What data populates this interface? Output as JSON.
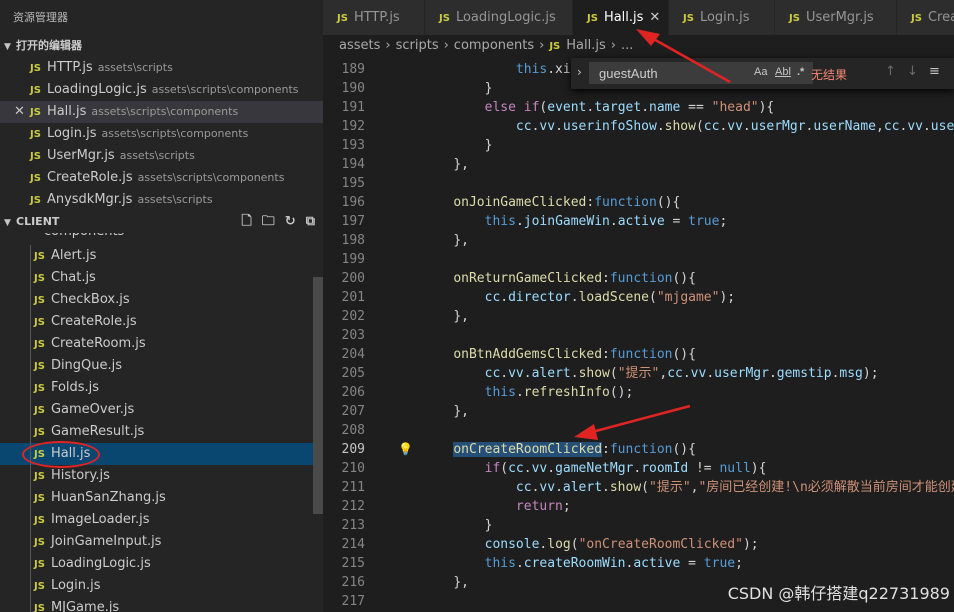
{
  "sidebar": {
    "title": "资源管理器",
    "open_editors_title": "打开的编辑器",
    "open_editors": [
      {
        "name": "HTTP.js",
        "path": "assets\\scripts"
      },
      {
        "name": "LoadingLogic.js",
        "path": "assets\\scripts\\components"
      },
      {
        "name": "Hall.js",
        "path": "assets\\scripts\\components"
      },
      {
        "name": "Login.js",
        "path": "assets\\scripts\\components"
      },
      {
        "name": "UserMgr.js",
        "path": "assets\\scripts"
      },
      {
        "name": "CreateRole.js",
        "path": "assets\\scripts\\components"
      },
      {
        "name": "AnysdkMgr.js",
        "path": "assets\\scripts"
      }
    ],
    "close_glyph": "✕",
    "client_title": "CLIENT",
    "folder": "components",
    "files": [
      "Alert.js",
      "Chat.js",
      "CheckBox.js",
      "CreateRole.js",
      "CreateRoom.js",
      "DingQue.js",
      "Folds.js",
      "GameOver.js",
      "GameResult.js",
      "Hall.js",
      "History.js",
      "HuanSanZhang.js",
      "ImageLoader.js",
      "JoinGameInput.js",
      "LoadingLogic.js",
      "Login.js",
      "MJGame.js"
    ],
    "js_badge": "JS"
  },
  "tabs": [
    {
      "label": "HTTP.js"
    },
    {
      "label": "LoadingLogic.js"
    },
    {
      "label": "Hall.js",
      "active": true
    },
    {
      "label": "Login.js"
    },
    {
      "label": "UserMgr.js"
    },
    {
      "label": "Crea"
    }
  ],
  "breadcrumb": [
    "assets",
    "scripts",
    "components",
    "Hall.js",
    "..."
  ],
  "find": {
    "value": "guestAuth",
    "match_case": "Aa",
    "whole_word": "Abl",
    "regex": ".*",
    "no_results": "无结果"
  },
  "code": {
    "current_line": 209,
    "lines": [
      {
        "n": "189",
        "html": "            <span class='k'>this</span><span class='t'>.xiaox</span>"
      },
      {
        "n": "190",
        "html": "        <span class='t'>}</span>"
      },
      {
        "n": "191",
        "html": "        <span class='kw'>else</span> <span class='kw'>if</span><span class='t'>(</span><span class='p'>event</span><span class='t'>.</span><span class='p'>target</span><span class='t'>.</span><span class='p'>name</span> <span class='t'>==</span> <span class='s'>\"head\"</span><span class='t'>){</span>"
      },
      {
        "n": "192",
        "html": "            <span class='p'>cc</span><span class='t'>.</span><span class='p'>vv</span><span class='t'>.</span><span class='p'>userinfoShow</span><span class='t'>.</span><span class='f'>show</span><span class='t'>(</span><span class='p'>cc</span><span class='t'>.</span><span class='p'>vv</span><span class='t'>.</span><span class='p'>userMgr</span><span class='t'>.</span><span class='p'>userName</span><span class='t'>,</span><span class='p'>cc</span><span class='t'>.</span><span class='p'>vv</span><span class='t'>.</span><span class='p'>userMgr</span><span class='t'>.</span>"
      },
      {
        "n": "193",
        "html": "        <span class='t'>}</span>"
      },
      {
        "n": "194",
        "html": "    <span class='t'>},</span>"
      },
      {
        "n": "195",
        "html": ""
      },
      {
        "n": "196",
        "html": "    <span class='f'>onJoinGameClicked</span><span class='t'>:</span><span class='k'>function</span><span class='t'>(){</span>"
      },
      {
        "n": "197",
        "html": "        <span class='k'>this</span><span class='t'>.</span><span class='p'>joinGameWin</span><span class='t'>.</span><span class='p'>active</span> <span class='t'>=</span> <span class='k'>true</span><span class='t'>;</span>"
      },
      {
        "n": "198",
        "html": "    <span class='t'>},</span>"
      },
      {
        "n": "199",
        "html": ""
      },
      {
        "n": "200",
        "html": "    <span class='f'>onReturnGameClicked</span><span class='t'>:</span><span class='k'>function</span><span class='t'>(){</span>"
      },
      {
        "n": "201",
        "html": "        <span class='p'>cc</span><span class='t'>.</span><span class='p'>director</span><span class='t'>.</span><span class='f'>loadScene</span><span class='t'>(</span><span class='s'>\"mjgame\"</span><span class='t'>);</span>"
      },
      {
        "n": "202",
        "html": "    <span class='t'>},</span>"
      },
      {
        "n": "203",
        "html": ""
      },
      {
        "n": "204",
        "html": "    <span class='f'>onBtnAddGemsClicked</span><span class='t'>:</span><span class='k'>function</span><span class='t'>(){</span>"
      },
      {
        "n": "205",
        "html": "        <span class='p'>cc</span><span class='t'>.</span><span class='p'>vv</span><span class='t'>.</span><span class='p'>alert</span><span class='t'>.</span><span class='f'>show</span><span class='t'>(</span><span class='s'>\"提示\"</span><span class='t'>,</span><span class='p'>cc</span><span class='t'>.</span><span class='p'>vv</span><span class='t'>.</span><span class='p'>userMgr</span><span class='t'>.</span><span class='p'>gemstip</span><span class='t'>.</span><span class='p'>msg</span><span class='t'>);</span>"
      },
      {
        "n": "206",
        "html": "        <span class='k'>this</span><span class='t'>.</span><span class='f'>refreshInfo</span><span class='t'>();</span>"
      },
      {
        "n": "207",
        "html": "    <span class='t'>},</span>"
      },
      {
        "n": "208",
        "html": ""
      },
      {
        "n": "209",
        "html": "    <span class='f hl'>onCreateRoomClicked</span><span class='t'>:</span><span class='k'>function</span><span class='t'>(){</span>"
      },
      {
        "n": "210",
        "html": "        <span class='kw'>if</span><span class='t'>(</span><span class='p'>cc</span><span class='t'>.</span><span class='p'>vv</span><span class='t'>.</span><span class='p'>gameNetMgr</span><span class='t'>.</span><span class='p'>roomId</span> <span class='t'>!=</span> <span class='k'>null</span><span class='t'>){</span>"
      },
      {
        "n": "211",
        "html": "            <span class='p'>cc</span><span class='t'>.</span><span class='p'>vv</span><span class='t'>.</span><span class='p'>alert</span><span class='t'>.</span><span class='f'>show</span><span class='t'>(</span><span class='s'>\"提示\"</span><span class='t'>,</span><span class='s'>\"房间已经创建!\\n必须解散当前房间才能创建新</span>"
      },
      {
        "n": "212",
        "html": "            <span class='kw'>return</span><span class='t'>;</span>"
      },
      {
        "n": "213",
        "html": "        <span class='t'>}</span>"
      },
      {
        "n": "214",
        "html": "        <span class='p'>console</span><span class='t'>.</span><span class='f'>log</span><span class='t'>(</span><span class='s'>\"onCreateRoomClicked\"</span><span class='t'>);</span>"
      },
      {
        "n": "215",
        "html": "        <span class='k'>this</span><span class='t'>.</span><span class='p'>createRoomWin</span><span class='t'>.</span><span class='p'>active</span> <span class='t'>=</span> <span class='k'>true</span><span class='t'>;</span>"
      },
      {
        "n": "216",
        "html": "    <span class='t'>},</span>"
      },
      {
        "n": "217",
        "html": ""
      }
    ]
  },
  "watermark": "CSDN @韩仔搭建q22731989",
  "colors": {
    "sidebar_bg": "#252526",
    "editor_bg": "#1e1e1e",
    "selection": "#094771",
    "annotation_red": "#e02424"
  }
}
